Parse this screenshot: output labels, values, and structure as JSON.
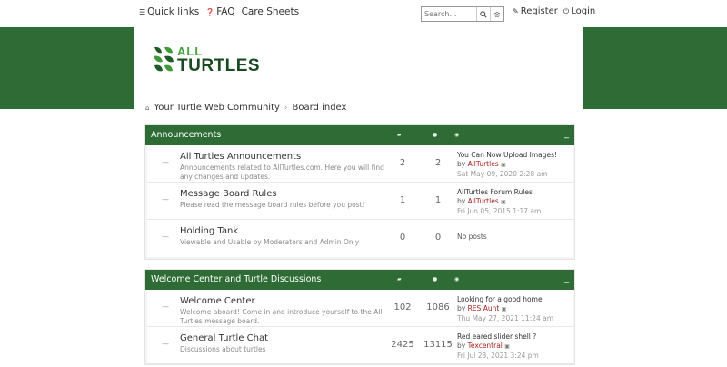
{
  "topnav": {
    "quick_links": "Quick links",
    "faq": "FAQ",
    "care_sheets": "Care Sheets",
    "search_placeholder": "Search…",
    "register": "Register",
    "login": "Login"
  },
  "logo": {
    "line1": "ALL",
    "line2": "TURTLES"
  },
  "breadcrumb": {
    "home": "Your Turtle Web Community",
    "board_index": "Board index"
  },
  "colors": {
    "brand_green": "#2e6b35",
    "author_red": "#a2241d"
  },
  "categories": [
    {
      "title": "Announcements",
      "forums": [
        {
          "name": "All Turtles Announcements",
          "desc": "Announcements related to AllTurtles.com. Here you will find any changes and updates.",
          "topics": "2",
          "posts": "2",
          "last_title": "You Can Now Upload Images!",
          "last_by": "by",
          "last_author": "AllTurtles",
          "last_time": "Sat May 09, 2020 2:28 am"
        },
        {
          "name": "Message Board Rules",
          "desc": "Please read the message board rules before you post!",
          "topics": "1",
          "posts": "1",
          "last_title": "AllTurtles Forum Rules",
          "last_by": "by",
          "last_author": "AllTurtles",
          "last_time": "Fri Jun 05, 2015 1:17 am"
        },
        {
          "name": "Holding Tank",
          "desc": "Viewable and Usable by Moderators and Admin Only",
          "topics": "0",
          "posts": "0",
          "last_title": "No posts"
        }
      ]
    },
    {
      "title": "Welcome Center and Turtle Discussions",
      "forums": [
        {
          "name": "Welcome Center",
          "desc": "Welcome aboard! Come in and introduce yourself to the All Turtles message board.",
          "topics": "102",
          "posts": "1086",
          "last_title": "Looking for a good home",
          "last_by": "by",
          "last_author": "RES Aunt",
          "last_time": "Thu May 27, 2021 11:24 am"
        },
        {
          "name": "General Turtle Chat",
          "desc": "Discussions about turtles",
          "topics": "2425",
          "posts": "13115",
          "last_title": "Red eared slider shell ?",
          "last_by": "by",
          "last_author": "Texcentral",
          "last_time": "Fri Jul 23, 2021 3:24 pm"
        }
      ]
    }
  ]
}
